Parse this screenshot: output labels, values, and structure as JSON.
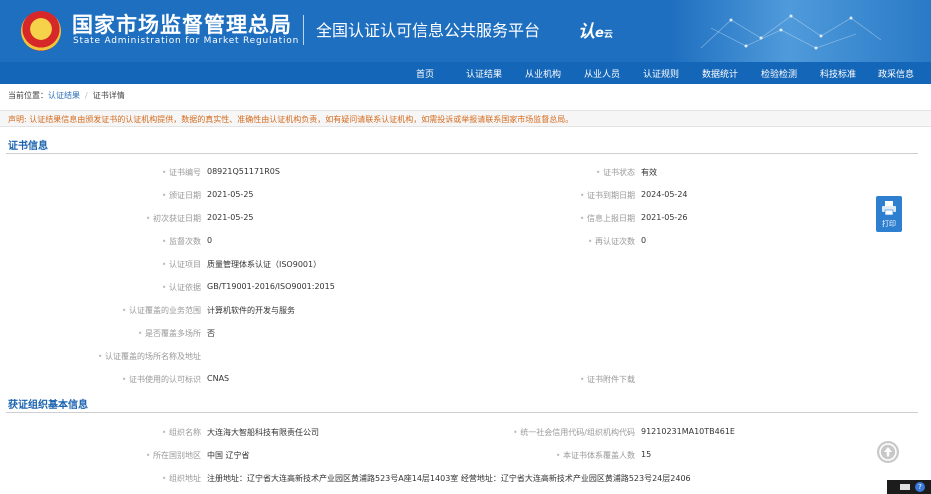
{
  "header": {
    "org_cn": "国家市场监督管理总局",
    "org_en": "State Administration  for  Market Regulation",
    "platform": "全国认证认可信息公共服务平台",
    "logo_text": "认",
    "logo_sub": "云"
  },
  "nav": {
    "items": [
      "首页",
      "认证结果",
      "从业机构",
      "从业人员",
      "认证规则",
      "数据统计",
      "检验检测",
      "科技标准",
      "政采信息"
    ]
  },
  "breadcrumb": {
    "prefix": "当前位置：",
    "link": "认证结果",
    "sep": "/",
    "current": "证书详情"
  },
  "notice": "声明: 认证结果信息由颁发证书的认证机构提供，数据的真实性、准确性由认证机构负责，如有疑问请联系认证机构，如需投诉或举报请联系国家市场监督总局。",
  "cert_section": {
    "title": "证书信息",
    "left": [
      {
        "label": "证书编号",
        "value": "08921Q51171R0S"
      },
      {
        "label": "颁证日期",
        "value": "2021-05-25"
      },
      {
        "label": "初次获证日期",
        "value": "2021-05-25"
      },
      {
        "label": "监督次数",
        "value": "0"
      },
      {
        "label": "认证项目",
        "value": "质量管理体系认证（ISO9001）"
      },
      {
        "label": "认证依据",
        "value": "GB/T19001-2016/ISO9001:2015"
      },
      {
        "label": "认证覆盖的业务范围",
        "value": "计算机软件的开发与服务"
      },
      {
        "label": "是否覆盖多场所",
        "value": "否"
      },
      {
        "label": "认证覆盖的场所名称及地址",
        "value": ""
      },
      {
        "label": "证书使用的认可标识",
        "value": "CNAS"
      }
    ],
    "right": [
      {
        "label": "证书状态",
        "value": "有效"
      },
      {
        "label": "证书到期日期",
        "value": "2024-05-24"
      },
      {
        "label": "信息上报日期",
        "value": "2021-05-26"
      },
      {
        "label": "再认证次数",
        "value": "0"
      },
      {
        "label": "证书附件下载",
        "value": ""
      }
    ]
  },
  "org_section": {
    "title": "获证组织基本信息",
    "left": [
      {
        "label": "组织名称",
        "value": "大连海大智船科技有限责任公司"
      },
      {
        "label": "所在国别地区",
        "value": "中国 辽宁省"
      },
      {
        "label": "组织地址",
        "value": "注册地址：辽宁省大连高新技术产业园区黄浦路523号A座14层1403室 经营地址：辽宁省大连高新技术产业园区黄浦路523号24层2406"
      }
    ],
    "right": [
      {
        "label": "统一社会信用代码/组织机构代码",
        "value": "91210231MA10TB461E"
      },
      {
        "label": "本证书体系覆盖人数",
        "value": "15"
      }
    ]
  },
  "print_label": "打印",
  "colors": {
    "header_blue": "#1e6fc0",
    "nav_blue": "#1466b8",
    "section_title": "#1a63b0",
    "notice_text": "#d46b1e"
  }
}
